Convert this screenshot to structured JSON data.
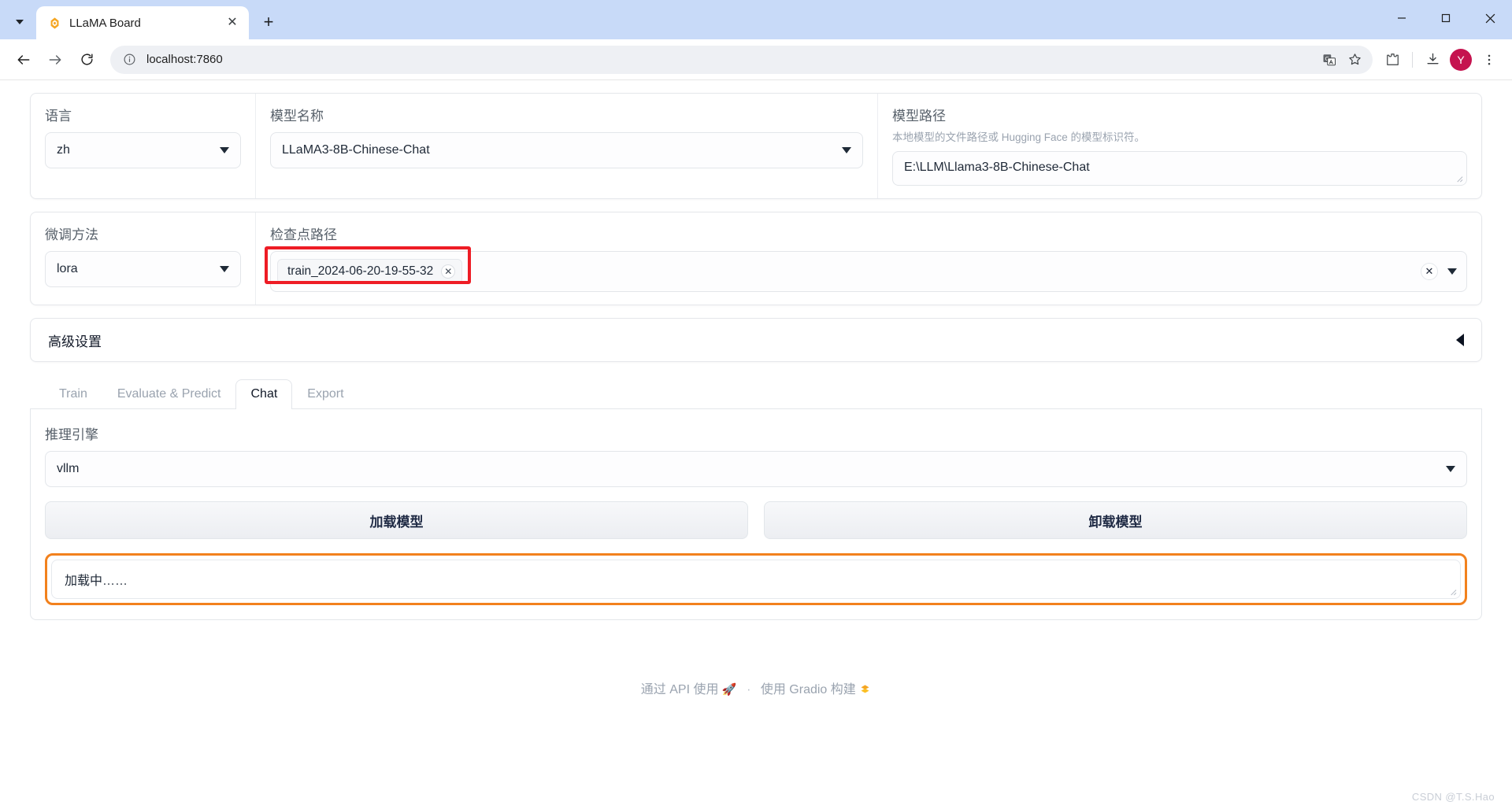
{
  "browser": {
    "tab": {
      "title": "LLaMA Board",
      "favicon_icon": "llama-board-favicon",
      "close_icon": "close-icon"
    },
    "tab_list_icon": "chevron-down-icon",
    "new_tab_icon": "plus-icon",
    "window_controls": {
      "minimize": "minimize-icon",
      "maximize": "maximize-icon",
      "close": "close-icon"
    },
    "nav": {
      "back": "back-arrow-icon",
      "forward": "forward-arrow-icon",
      "reload": "reload-icon"
    },
    "omnibox": {
      "site_info_icon": "info-circle-icon",
      "url": "localhost:7860"
    },
    "toolbar_right": {
      "translate_icon": "translate-icon",
      "bookmark_icon": "star-icon",
      "extensions_icon": "extensions-puzzle-icon",
      "downloads_icon": "download-icon",
      "profile_initial": "Y",
      "menu_icon": "three-dots-vertical-icon"
    }
  },
  "form": {
    "language": {
      "label": "语言",
      "value": "zh"
    },
    "model_name": {
      "label": "模型名称",
      "value": "LLaMA3-8B-Chinese-Chat"
    },
    "model_path": {
      "label": "模型路径",
      "description": "本地模型的文件路径或 Hugging Face 的模型标识符。",
      "value": "E:\\LLM\\Llama3-8B-Chinese-Chat"
    },
    "finetuning_method": {
      "label": "微调方法",
      "value": "lora"
    },
    "checkpoint_path": {
      "label": "检查点路径",
      "tags": [
        "train_2024-06-20-19-55-32"
      ],
      "tag_remove_icon": "close-icon",
      "clear_icon": "clear-x-icon",
      "dropdown_icon": "chevron-down-icon"
    }
  },
  "advanced": {
    "title": "高级设置",
    "arrow_icon": "triangle-left-icon"
  },
  "tabs": [
    {
      "label": "Train",
      "active": false
    },
    {
      "label": "Evaluate & Predict",
      "active": false
    },
    {
      "label": "Chat",
      "active": true
    },
    {
      "label": "Export",
      "active": false
    }
  ],
  "chat_panel": {
    "infer_engine": {
      "label": "推理引擎",
      "value": "vllm",
      "dropdown_icon": "chevron-down-icon"
    },
    "load_button": "加载模型",
    "unload_button": "卸载模型",
    "status": "加载中……"
  },
  "footer": {
    "api_text": "通过 API 使用",
    "api_icon": "rocket-icon",
    "separator": "·",
    "built_text": "使用 Gradio 构建",
    "gradio_icon": "gradio-logo-icon"
  },
  "watermark": "CSDN @T.S.Hao",
  "colors": {
    "tabstrip": "#c8daf8",
    "accent_orange": "#f2811d",
    "annotation_red": "#ee1c25",
    "avatar": "#c5134f"
  }
}
